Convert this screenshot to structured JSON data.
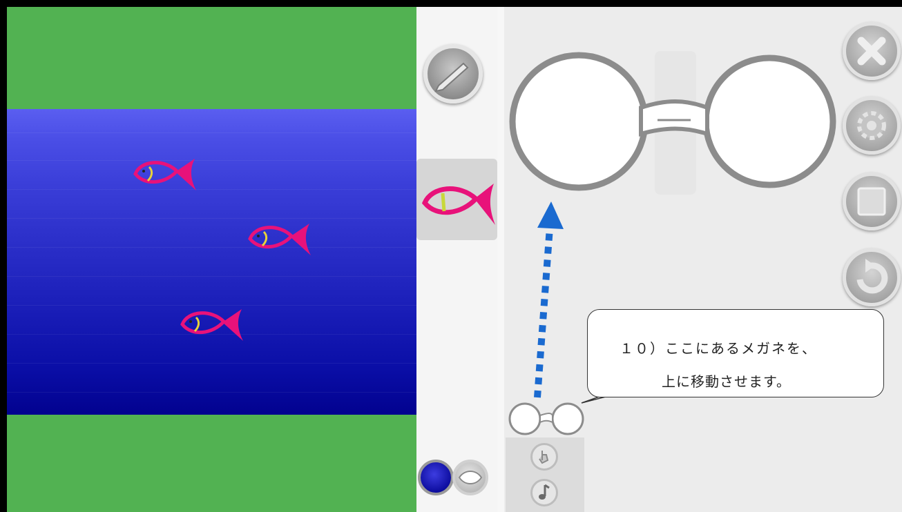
{
  "stage": {
    "sprites": [
      {
        "name": "fish-1"
      },
      {
        "name": "fish-2"
      },
      {
        "name": "fish-3"
      }
    ],
    "colors": {
      "grass": "#52b252",
      "water_top": "#5a5ef0",
      "water_bottom": "#02028f"
    }
  },
  "sprite_panel": {
    "edit_button_icon": "pencil-icon",
    "selected_sprite_icon": "fish-icon",
    "backgrounds": [
      "blue-background-icon",
      "pattern-background-icon"
    ]
  },
  "editor": {
    "main_block_icon": "glasses-icon",
    "toolbar": [
      "close-icon",
      "gear-icon",
      "square-icon",
      "undo-icon"
    ],
    "palette": [
      "glasses-block-icon",
      "hand-tap-icon",
      "music-note-icon"
    ]
  },
  "callout": {
    "line1": "１０）ここにあるメガネを、",
    "line2": "上に移動させます。",
    "arrow_color": "#1a6ad0"
  }
}
